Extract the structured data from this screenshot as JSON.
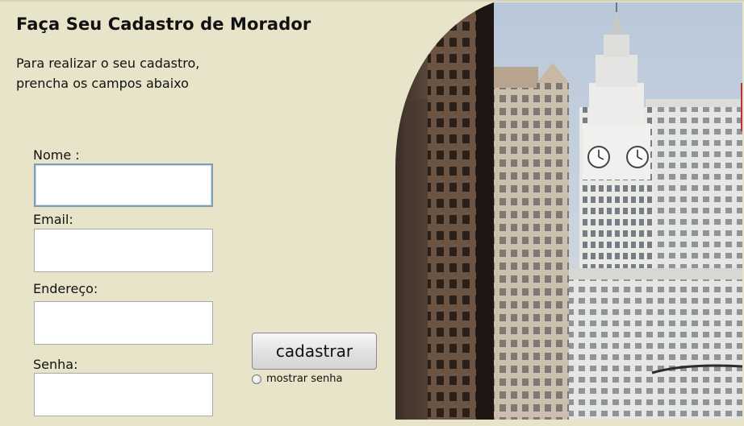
{
  "header": {
    "title": "Faça Seu Cadastro de Morador",
    "subtitle_line1": "Para realizar o seu cadastro,",
    "subtitle_line2": "prencha os campos abaixo"
  },
  "form": {
    "fields": [
      {
        "label": "Nome :",
        "value": "",
        "placeholder": ""
      },
      {
        "label": "Email:",
        "value": "",
        "placeholder": ""
      },
      {
        "label": "Endereço:",
        "value": "",
        "placeholder": ""
      },
      {
        "label": "Senha:",
        "value": "",
        "placeholder": ""
      }
    ],
    "submit_label": "cadastrar",
    "show_password_label": "mostrar senha",
    "show_password_checked": false
  },
  "image": {
    "description_icon": "city-building-photo"
  },
  "colors": {
    "background": "#e8e4c9",
    "focus_border": "#7f9db9"
  }
}
